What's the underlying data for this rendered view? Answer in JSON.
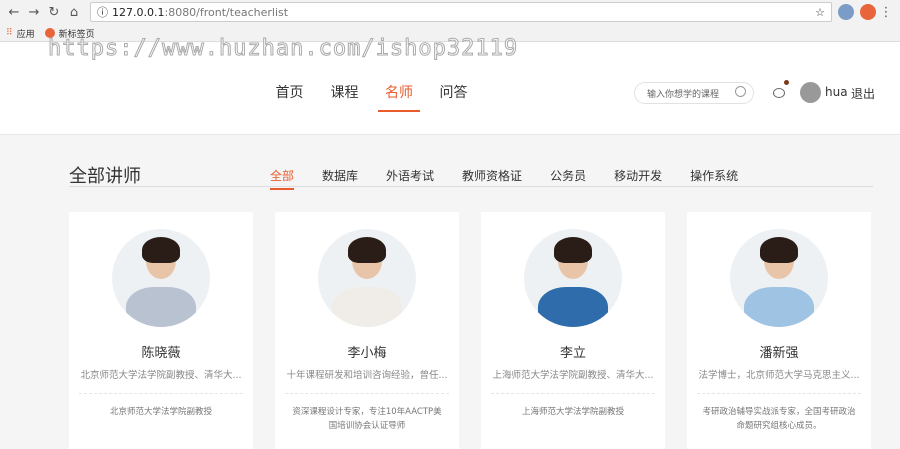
{
  "browser": {
    "url_host": "127.0.0.1",
    "url_path": ":8080/front/teacherlist",
    "bookmarks": [
      "应用",
      "新标签页"
    ]
  },
  "watermark": "https://www.huzhan.com/ishop32119",
  "nav": [
    "首页",
    "课程",
    "名师",
    "问答"
  ],
  "search": {
    "placeholder": "输入你想学的课程"
  },
  "user": {
    "name": "hua",
    "logout": "退出"
  },
  "section": {
    "title": "全部讲师",
    "tabs": [
      "全部",
      "数据库",
      "外语考试",
      "教师资格证",
      "公务员",
      "移动开发",
      "操作系统"
    ]
  },
  "teachers": [
    {
      "name": "陈晓薇",
      "desc": "北京师范大学法学院副教授、清华大...",
      "bio": "北京师范大学法学院副教授",
      "color": "#b8c2d0"
    },
    {
      "name": "李小梅",
      "desc": "十年课程研发和培训咨询经验，曾任...",
      "bio": "资深课程设计专家，专注10年AACTP美国培训协会认证导师",
      "color": "#f0ede8"
    },
    {
      "name": "李立",
      "desc": "上海师范大学法学院副教授、清华大...",
      "bio": "上海师范大学法学院副教授",
      "color": "#2f6cab"
    },
    {
      "name": "潘新强",
      "desc": "法学博士，北京师范大学马克思主义...",
      "bio": "考研政治辅导实战派专家，全国考研政治命题研究组核心成员。",
      "color": "#9ec3e3"
    }
  ]
}
